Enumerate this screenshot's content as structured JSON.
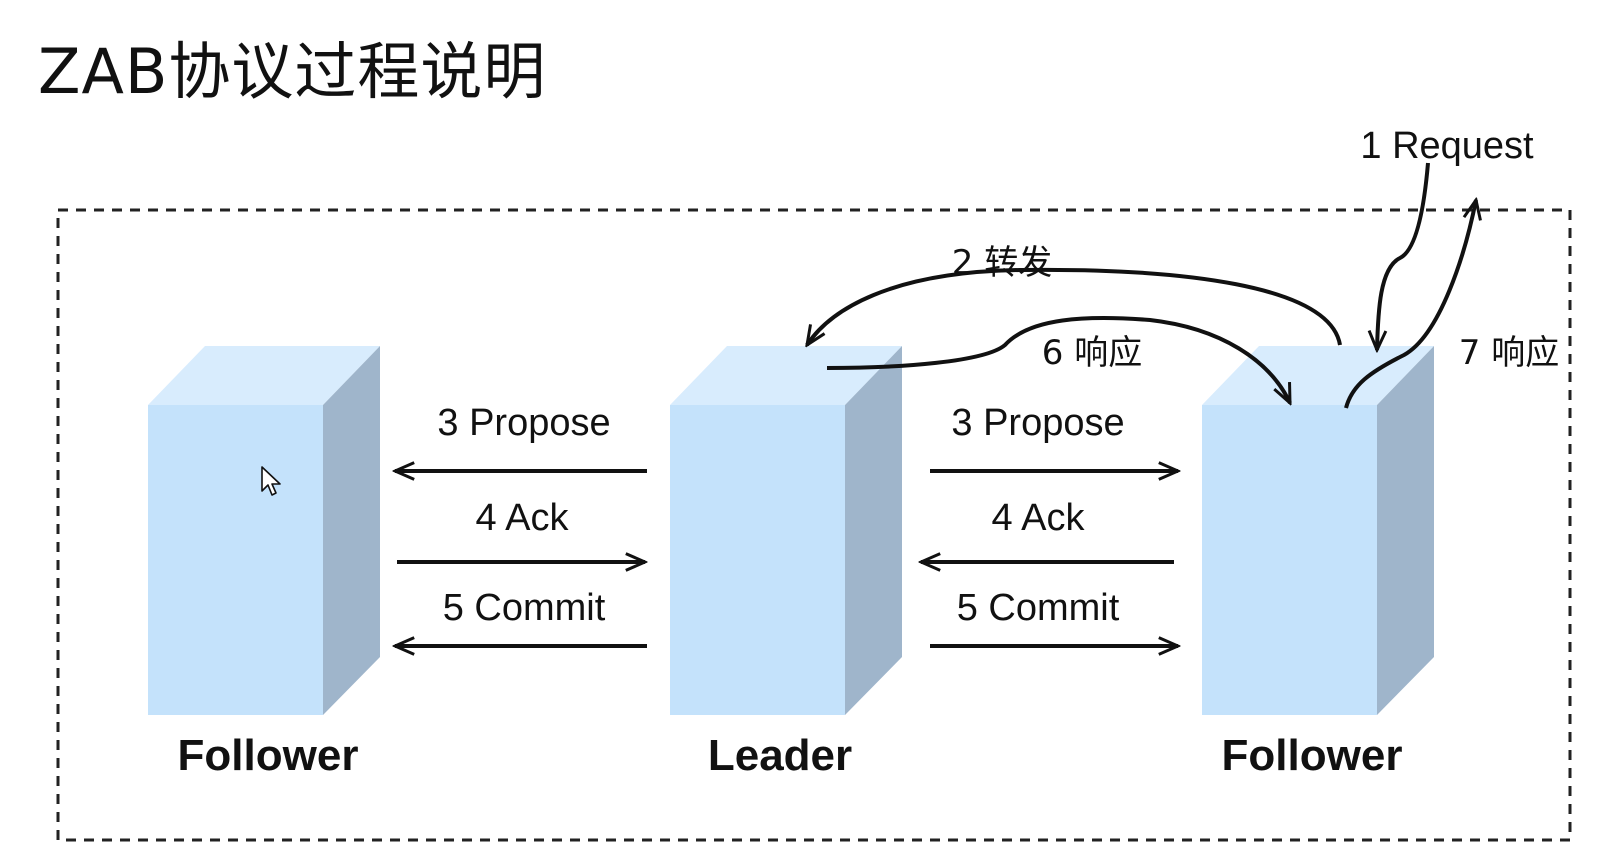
{
  "title": "ZAB协议过程说明",
  "nodes": {
    "left": "Follower",
    "center": "Leader",
    "right": "Follower"
  },
  "messages": {
    "request": "1 Request",
    "forward": "2 转发",
    "propose": "3 Propose",
    "ack": "4 Ack",
    "commit": "5 Commit",
    "response6": "6 响应",
    "response7": "7 响应"
  },
  "colors": {
    "box_front": "#c4e2fb",
    "box_top": "#d8ecfd",
    "box_side": "#9fb5cb",
    "border": "#222222"
  }
}
